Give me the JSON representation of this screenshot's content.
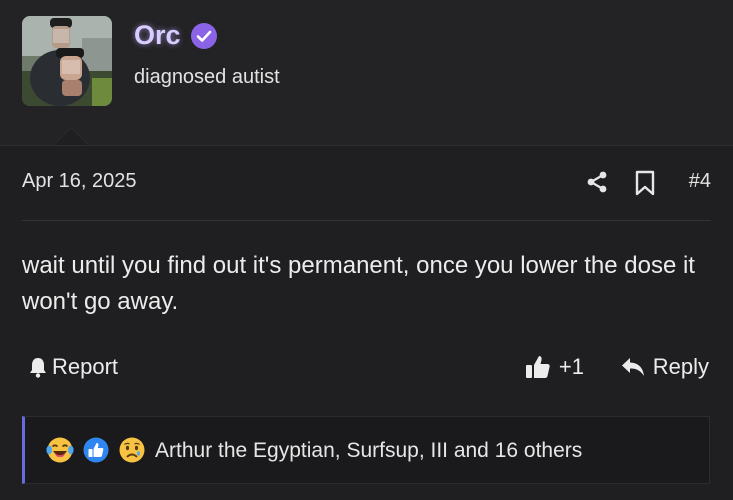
{
  "author": {
    "username": "Orc",
    "user_title": "diagnosed autist",
    "verified_icon": "verified-badge-icon",
    "username_color": "#d9ccff"
  },
  "post": {
    "date": "Apr 16, 2025",
    "number": "#4",
    "message": "wait until you find out it's permanent, once you lower the dose it won't go away."
  },
  "actions": {
    "report_label": "Report",
    "like_count": "+1",
    "reply_label": "Reply"
  },
  "reactions": {
    "icons": [
      "crying-laughing-emoji-icon",
      "thumbs-up-emoji-icon",
      "sad-face-emoji-icon"
    ],
    "summary": "Arthur the Egyptian, Surfsup, III and 16 others",
    "accent_color": "#6a6ae0"
  },
  "colors": {
    "background": "#1f1f21",
    "header_background": "#232325",
    "verified_badge": "#8a63e6"
  }
}
